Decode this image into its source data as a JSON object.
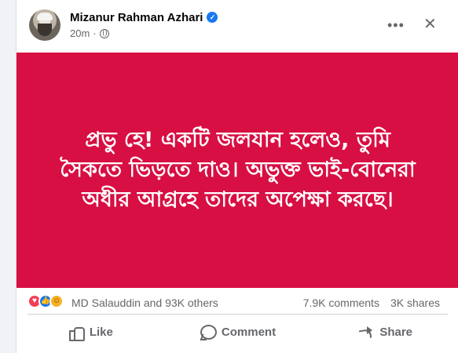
{
  "post": {
    "author": "Mizanur Rahman Azhari",
    "time": "20m",
    "more_label": "•••",
    "close_label": "✕",
    "text": "প্রভু হে! একটি জলযান হলেও, তুমি সৈকতে ভিড়তে দাও। অভুক্ত ভাই-বোনেরা অধীর আগ্রহে তাদের অপেক্ষা করছে।",
    "background_color": "#d80f43"
  },
  "stats": {
    "reacted_by": "MD Salauddin and 93K others",
    "comments": "7.9K comments",
    "shares": "3K shares",
    "reaction_icons": [
      "love-icon",
      "like-icon",
      "care-icon"
    ]
  },
  "actions": {
    "like_label": "Like",
    "comment_label": "Comment",
    "share_label": "Share"
  },
  "colors": {
    "accent": "#1877f2",
    "text_secondary": "#65676b"
  }
}
